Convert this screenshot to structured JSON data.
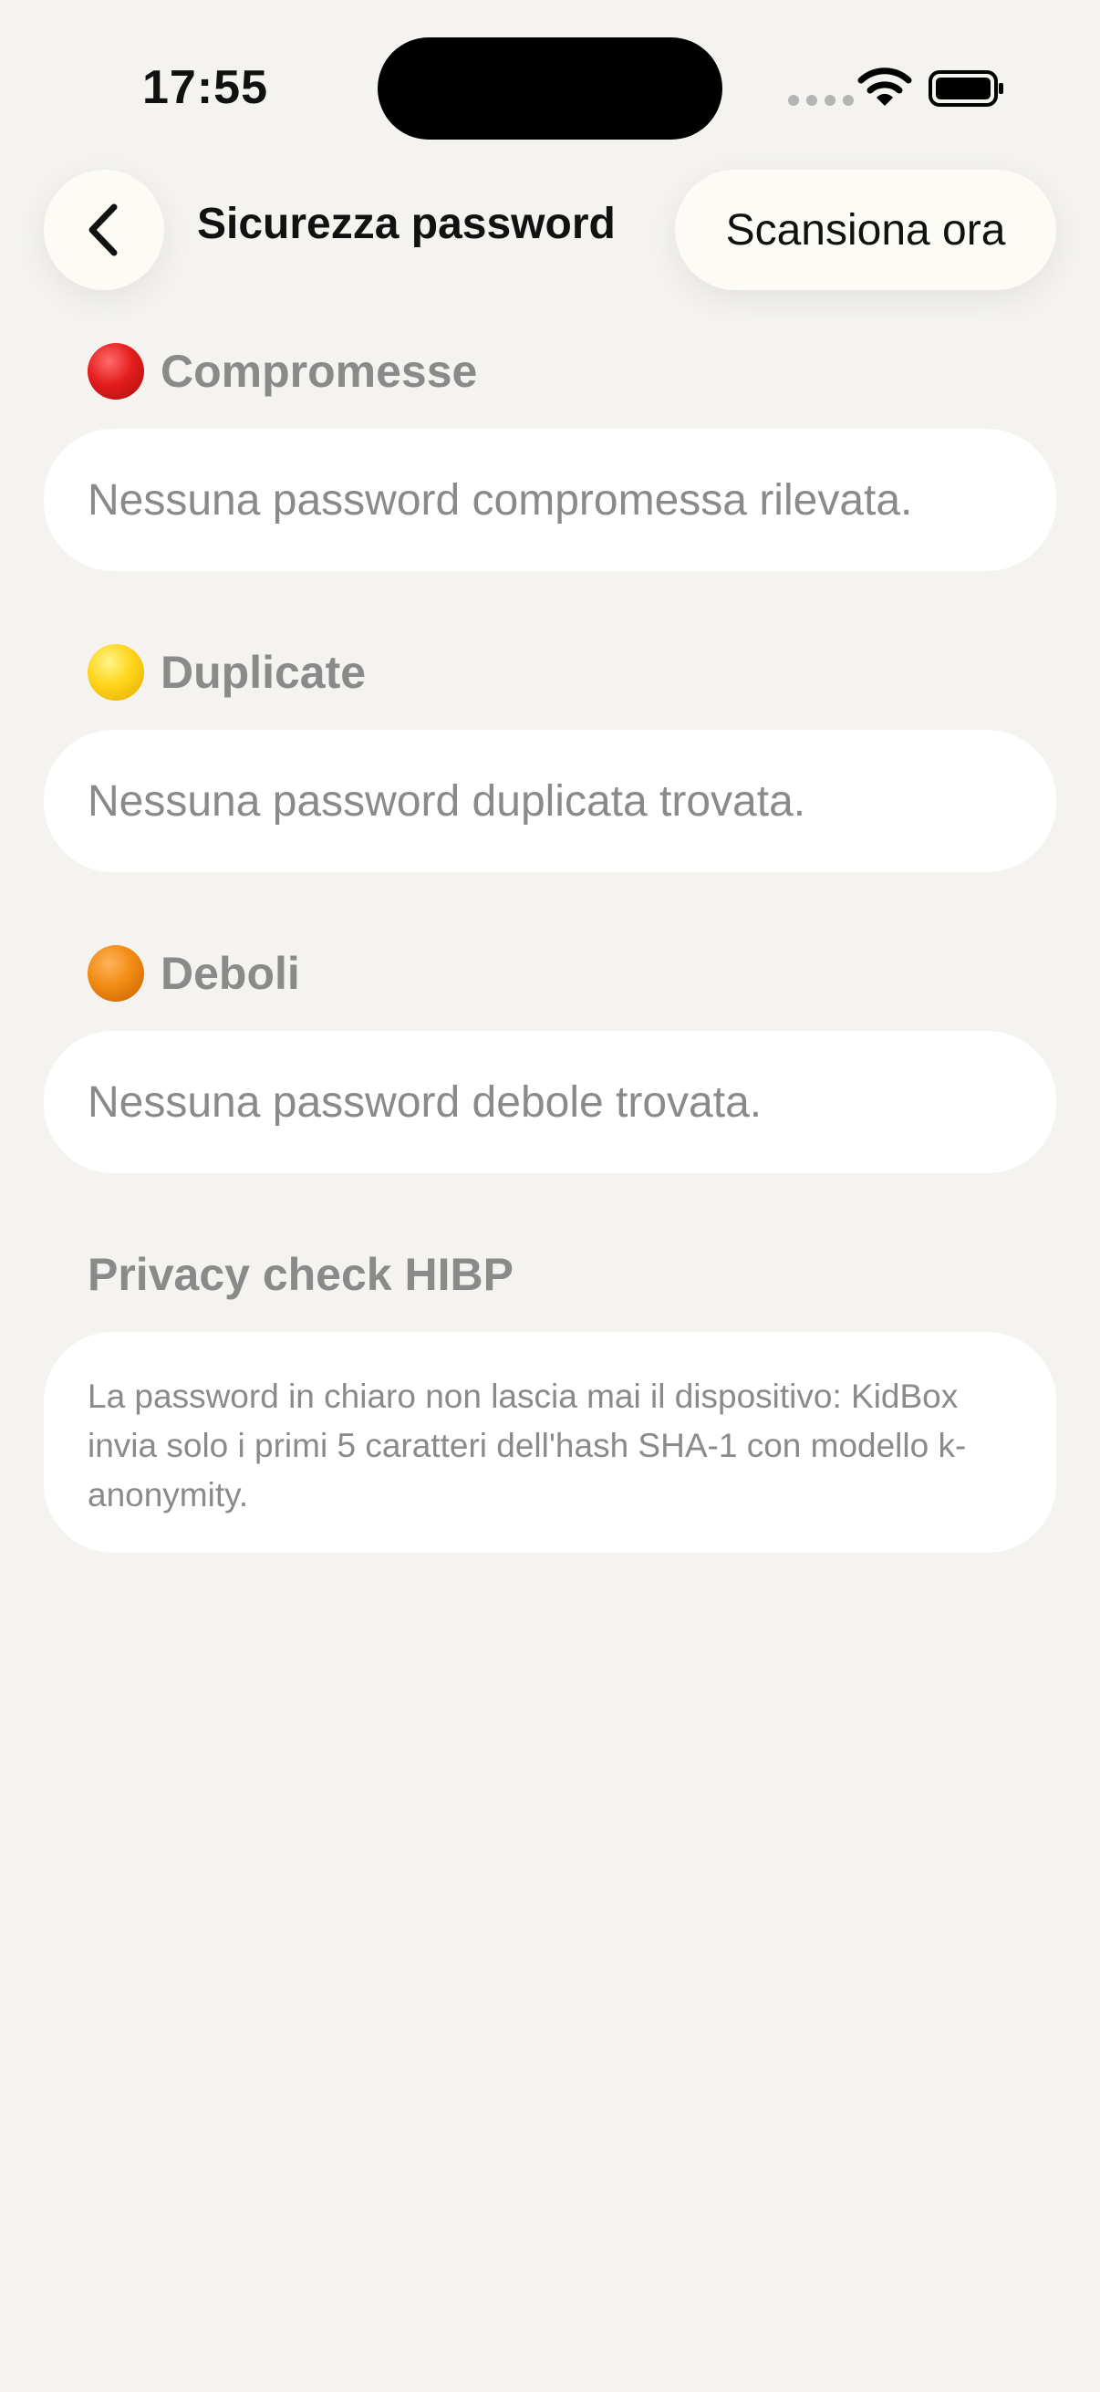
{
  "status_bar": {
    "time": "17:55"
  },
  "nav": {
    "back_icon": "chevron-left-icon",
    "title": "Sicurezza password",
    "scan_label": "Scansiona ora"
  },
  "sections": {
    "compromised": {
      "title": "Compromesse",
      "dot_color": "#e51d1d",
      "message": "Nessuna password compromessa rilevata."
    },
    "duplicate": {
      "title": "Duplicate",
      "dot_color": "#ffd51a",
      "message": "Nessuna password duplicata trovata."
    },
    "weak": {
      "title": "Deboli",
      "dot_color": "#f18b12",
      "message": "Nessuna password debole trovata."
    },
    "privacy": {
      "title": "Privacy check HIBP",
      "message": "La password in chiaro non lascia mai il dispositivo: KidBox invia solo i primi 5 caratteri dell'hash SHA-1 con modello k-anonymity."
    }
  },
  "colors": {
    "background": "#f4f3f0",
    "card": "#ffffff",
    "muted_text": "#8a8a8a"
  }
}
